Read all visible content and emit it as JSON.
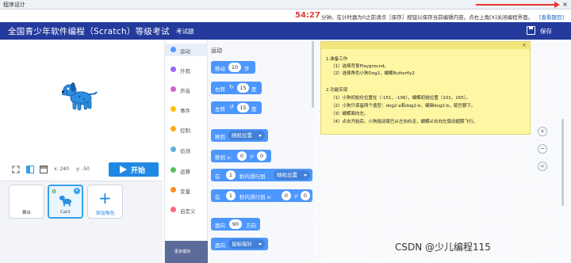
{
  "window": {
    "title": "程序设计",
    "close_glyph": "×"
  },
  "infobar": {
    "timer": "54:27",
    "message": "分钟。在计时器为0之前请点［保存］按钮以保存当前编辑内容。点右上角[X]关闭编程界面。",
    "help_link": "[查看题目]"
  },
  "header": {
    "exam_title": "全国青少年软件编程（Scratch）等级考试",
    "tab": "考试题",
    "save_label": "保存"
  },
  "stage": {
    "x_label": "x: 240",
    "y_label": "y: -50",
    "start_label": "开始"
  },
  "sprites": {
    "stage_card": "舞台",
    "sprite_name": "Cat1",
    "add_label": "添加角色"
  },
  "categories": [
    {
      "label": "运动",
      "color": "#4c97ff",
      "selected": true
    },
    {
      "label": "外观",
      "color": "#9966ff"
    },
    {
      "label": "声音",
      "color": "#cf63cf"
    },
    {
      "label": "事件",
      "color": "#ffbf00"
    },
    {
      "label": "控制",
      "color": "#ffab19"
    },
    {
      "label": "侦测",
      "color": "#5cb1d6"
    },
    {
      "label": "运算",
      "color": "#59c059"
    },
    {
      "label": "变量",
      "color": "#ff8c1a"
    },
    {
      "label": "自定义",
      "color": "#ff6680"
    }
  ],
  "more_blocks": "更多模块",
  "palette": {
    "heading": "运动",
    "move": {
      "label": "移动",
      "value": "10",
      "unit": "步"
    },
    "turn_right": {
      "label": "右转",
      "glyph": "↻",
      "value": "15",
      "unit": "度"
    },
    "turn_left": {
      "label": "左转",
      "glyph": "↺",
      "value": "15",
      "unit": "度"
    },
    "goto": {
      "label": "移到",
      "dropdown": "随机位置"
    },
    "goto_xy": {
      "label": "移到 x:",
      "x": "0",
      "ylabel": "y:",
      "y": "0"
    },
    "glide_to": {
      "pre": "在",
      "value": "1",
      "mid": "秒内滑行到",
      "dropdown": "随机位置"
    },
    "glide_xy": {
      "pre": "在",
      "value": "1",
      "mid": "秒内滑行到 x:",
      "x": "0",
      "ylabel": "y:",
      "y": "0"
    },
    "point_dir": {
      "label": "面向",
      "value": "90",
      "unit": "方向"
    },
    "point_toward": {
      "label": "面向",
      "dropdown": "鼠标指针"
    }
  },
  "note": {
    "close_glyph": "×",
    "lines": [
      "1.准备工作",
      "（1）选择背景Playground。",
      "（2）选择角色小狗Dog2，蝴蝶Butterfly2",
      "",
      "2.功能实现",
      "（1）小狗初始化位置在（-151，-106），蝴蝶初始位置（101，165）。",
      "（2）小狗只保留两个造型：dog2-a和dog2-b，编辑dog2-b，尾巴朝下。",
      "（3）蝴蝶面向左。",
      "（4）点去开始后，小狗摇动尾巴从左向右走，蝴蝶从右向左扇动翅膀飞行。"
    ]
  },
  "zoom": {
    "in_glyph": "+",
    "out_glyph": "−",
    "reset_glyph": "="
  },
  "watermark": "CSDN @少儿编程115"
}
